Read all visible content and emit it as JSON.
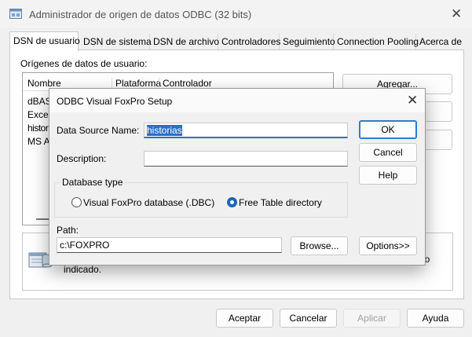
{
  "window": {
    "title": "Administrador de origen de datos ODBC (32 bits)",
    "close_glyph": "✕",
    "app_icon": "odbc-admin-icon"
  },
  "tabs": [
    {
      "label": "DSN de usuario",
      "active": true
    },
    {
      "label": "DSN de sistema"
    },
    {
      "label": "DSN de archivo"
    },
    {
      "label": "Controladores"
    },
    {
      "label": "Seguimiento"
    },
    {
      "label": "Connection Pooling"
    },
    {
      "label": "Acerca de"
    }
  ],
  "sources": {
    "label": "Orígenes de datos de usuario:",
    "columns": [
      "Nombre",
      "Plataforma",
      "Controlador"
    ],
    "rows": [
      "dBASE",
      "Excel",
      "historias",
      "MS Ac"
    ]
  },
  "side_buttons": [
    "Agregar..."
  ],
  "info": {
    "fragment": "io",
    "text": "indicado."
  },
  "footer": {
    "accept": "Aceptar",
    "cancel": "Cancelar",
    "apply": "Aplicar",
    "help": "Ayuda"
  },
  "modal": {
    "title": "ODBC Visual FoxPro Setup",
    "close_glyph": "✕",
    "dsn_label": "Data Source Name:",
    "dsn_value": "historias",
    "desc_label": "Description:",
    "desc_value": "",
    "ok": "OK",
    "cancel": "Cancel",
    "help": "Help",
    "db_type_label": "Database type",
    "radio_dbc": "Visual FoxPro database (.DBC)",
    "radio_free": "Free Table directory",
    "selected_type": "Free Table directory",
    "path_label": "Path:",
    "path_value": "c:\\FOXPRO",
    "browse": "Browse...",
    "options": "Options>>"
  },
  "colors": {
    "accent": "#1e64b7",
    "selection": "#2a6fc9",
    "background": "#f0f0f0"
  }
}
